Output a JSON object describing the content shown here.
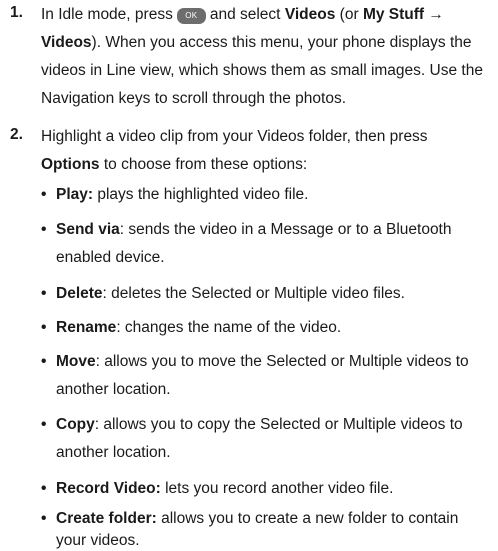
{
  "steps": [
    {
      "number": "1.",
      "lines": {
        "l1_pre": "In Idle mode, press",
        "l1_key": "OK",
        "l1_mid": "and select",
        "l1_bold1": "Videos",
        "l1_paren": "(or",
        "l1_bold2": "My Stuff →",
        "l2_bold": "Videos",
        "l2_rest": "). When you access this menu, your phone displays the",
        "l3": "videos in Line view, which shows them as small images. Use the",
        "l4": "Navigation keys to scroll through the photos."
      }
    },
    {
      "number": "2.",
      "lines": {
        "l1": "Highlight a video clip from your Videos folder, then press",
        "l2_bold": "Options",
        "l2_rest": "to choose from these options:"
      }
    }
  ],
  "bullet_symbol": "•",
  "options": [
    {
      "term": "Play:",
      "desc_1": " plays the highlighted video file.",
      "desc_2": ""
    },
    {
      "term": "Send via",
      "desc_1": ": sends the video in a Message or to a Bluetooth",
      "desc_2": "enabled device."
    },
    {
      "term": "Delete",
      "desc_1": ": deletes the Selected or Multiple video files.",
      "desc_2": ""
    },
    {
      "term": "Rename",
      "desc_1": ": changes the name of the video.",
      "desc_2": ""
    },
    {
      "term": "Move",
      "desc_1": ": allows you to move the Selected or Multiple videos to",
      "desc_2": "another location."
    },
    {
      "term": "Copy",
      "desc_1": ": allows you to copy the Selected or Multiple videos to",
      "desc_2": "another location."
    },
    {
      "term": "Record Video:",
      "desc_1": " lets you record another video file.",
      "desc_2": ""
    },
    {
      "term": "Create folder:",
      "desc_1": " allows you to create a new folder to contain",
      "desc_2": "your videos."
    }
  ]
}
